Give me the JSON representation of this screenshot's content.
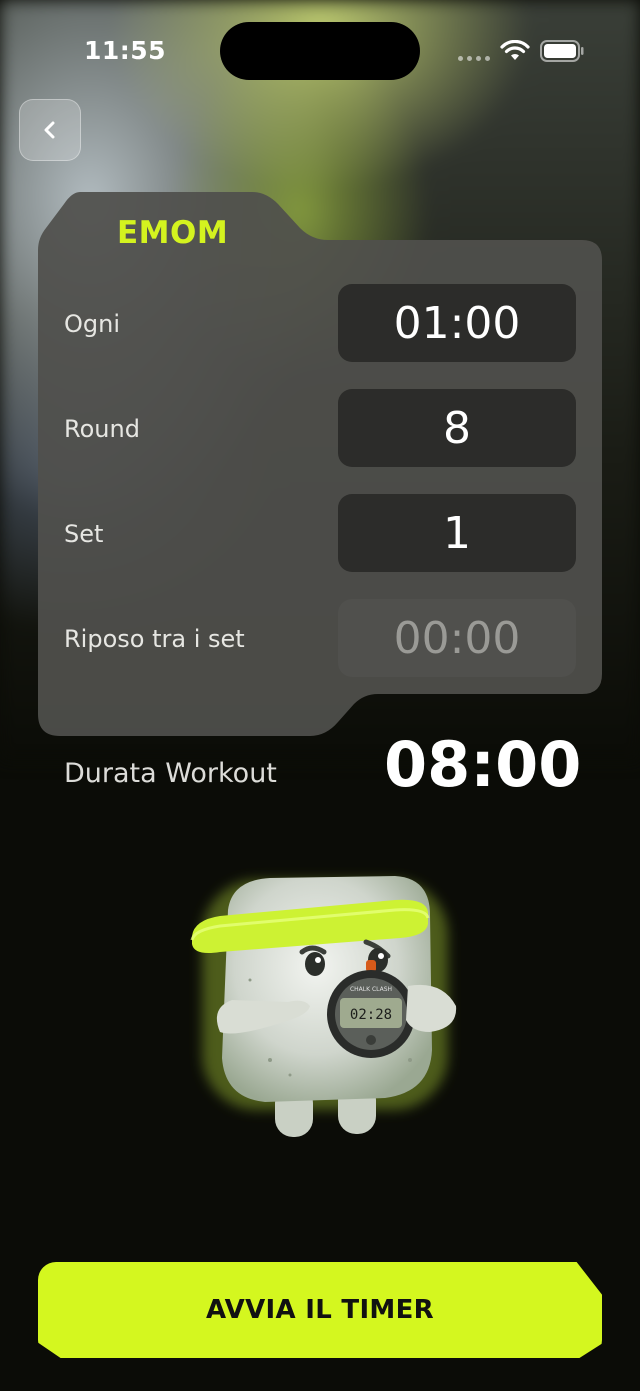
{
  "status_bar": {
    "time": "11:55"
  },
  "card": {
    "tab_label": "EMOM",
    "rows": [
      {
        "label": "Ogni",
        "value": "01:00"
      },
      {
        "label": "Round",
        "value": "8"
      },
      {
        "label": "Set",
        "value": "1"
      },
      {
        "label": "Riposo tra i set",
        "value": "00:00"
      }
    ]
  },
  "summary": {
    "label": "Durata Workout",
    "value": "08:00"
  },
  "mascot": {
    "watch_display": "02:28",
    "watch_brand": "CHALK CLASH"
  },
  "start_button": {
    "label": "AVVIA IL TIMER"
  },
  "colors": {
    "accent": "#d4f71f",
    "card": "#4b4b48",
    "value_box": "#2c2c2a",
    "background": "#0b0c07"
  },
  "icons": {
    "back": "chevron-left-icon",
    "wifi": "wifi-icon",
    "battery": "battery-icon"
  }
}
